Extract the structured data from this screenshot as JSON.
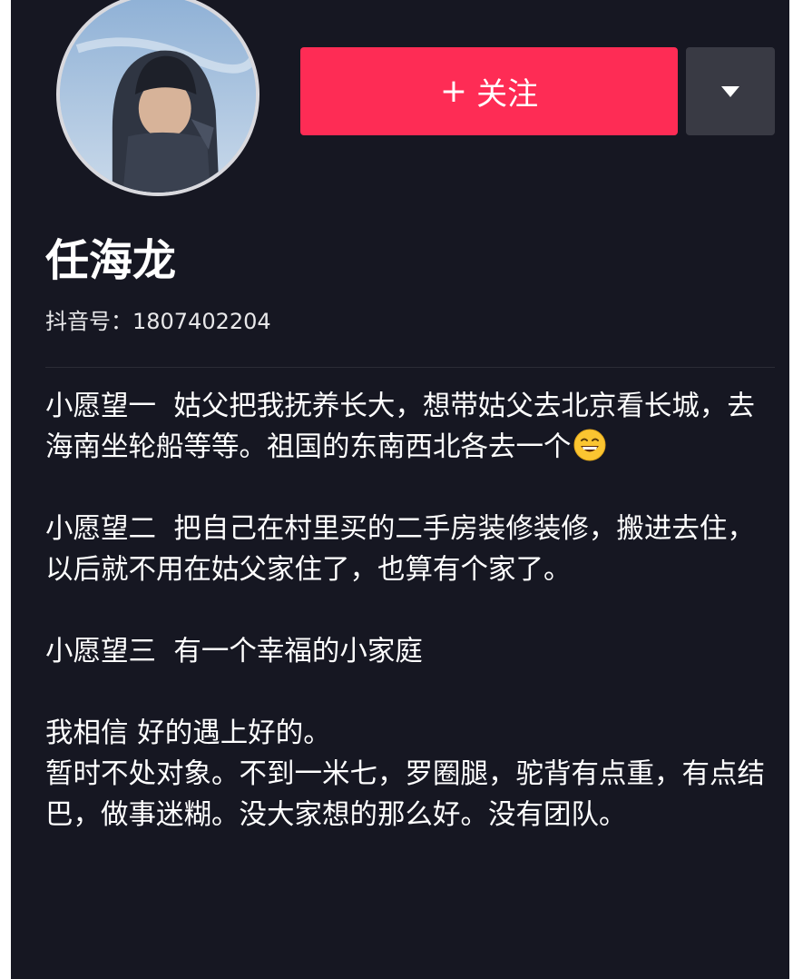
{
  "profile": {
    "name": "任海龙",
    "douyin_id_label": "抖音号：",
    "douyin_id": "1807402204",
    "follow_plus": "+",
    "follow_label": "关注",
    "more_icon": "triangle-down-icon",
    "avatar_icon": "avatar-photo"
  },
  "bio": {
    "wish1": "小愿望一  姑父把我抚养长大，想带姑父去北京看长城，去海南坐轮船等等。祖国的东南西北各去一个",
    "wish1_emoji": "grinning-face-emoji",
    "wish2": "小愿望二  把自己在村里买的二手房装修装修，搬进去住，以后就不用在姑父家住了，也算有个家了。",
    "wish3": "小愿望三  有一个幸福的小家庭",
    "line4": "我相信 好的遇上好的。",
    "line5": "暂时不处对象。不到一米七，罗圈腿，驼背有点重，有点结巴，做事迷糊。没大家想的那么好。没有团队。"
  },
  "colors": {
    "background": "#161722",
    "follow_button": "#fe2c55",
    "more_button": "#393a44",
    "text": "#ffffff"
  }
}
